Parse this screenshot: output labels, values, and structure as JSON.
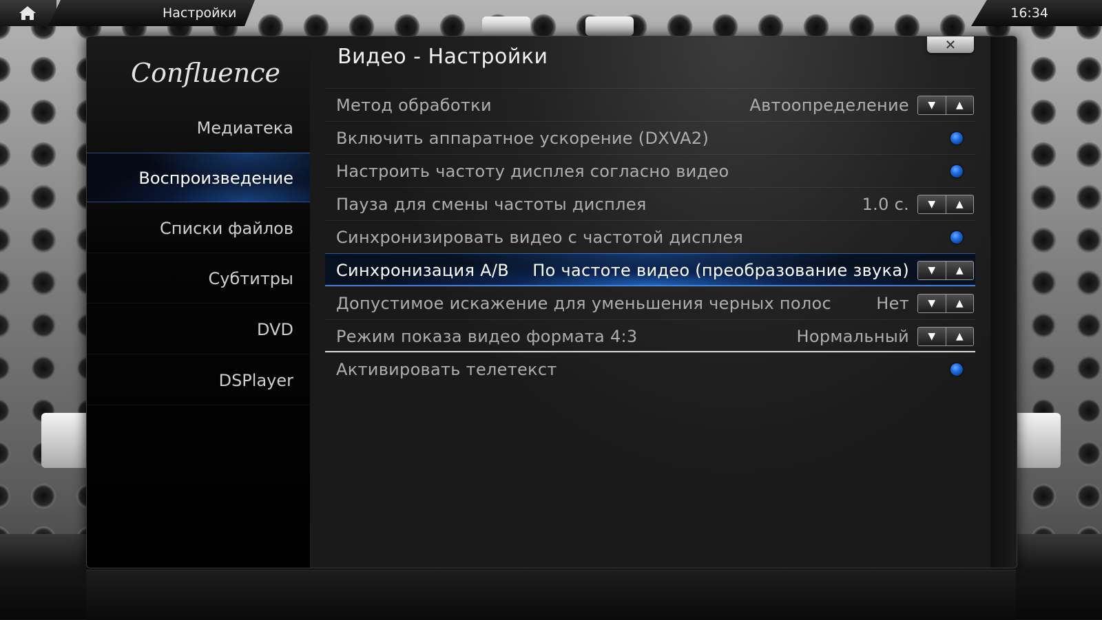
{
  "topbar": {
    "home_icon": "home-icon",
    "title": "Настройки",
    "clock": "16:34"
  },
  "dialog": {
    "logo_text": "Confluence",
    "header": "Видео - Настройки",
    "close_label": "✕"
  },
  "sidebar": {
    "items": [
      {
        "label": "Медиатека",
        "active": false
      },
      {
        "label": "Воспроизведение",
        "active": true
      },
      {
        "label": "Списки файлов",
        "active": false
      },
      {
        "label": "Субтитры",
        "active": false
      },
      {
        "label": "DVD",
        "active": false
      },
      {
        "label": "DSPlayer",
        "active": false
      }
    ]
  },
  "settings": [
    {
      "label": "Метод обработки",
      "value": "Автоопределение",
      "control": "spinner"
    },
    {
      "label": "Включить аппаратное ускорение (DXVA2)",
      "value": "",
      "control": "radio"
    },
    {
      "label": "Настроить частоту дисплея согласно видео",
      "value": "",
      "control": "radio"
    },
    {
      "label": "Пауза для смены частоты дисплея",
      "value": "1.0 с.",
      "control": "spinner"
    },
    {
      "label": "Синхронизировать видео с частотой дисплея",
      "value": "",
      "control": "radio"
    },
    {
      "label": "Синхронизация A/B",
      "value": "По частоте видео (преобразование звука)",
      "control": "spinner",
      "focused": true
    },
    {
      "label": "Допустимое искажение для уменьшения черных полос",
      "value": "Нет",
      "control": "spinner"
    },
    {
      "label": "Режим показа видео формата 4:3",
      "value": "Нормальный",
      "control": "spinner"
    },
    {
      "label": "Активировать телетекст",
      "value": "",
      "control": "radio"
    }
  ],
  "spinner": {
    "down": "▼",
    "up": "▲"
  },
  "colors": {
    "accent": "#1e6be0",
    "focus_glow": "#2878e6"
  }
}
